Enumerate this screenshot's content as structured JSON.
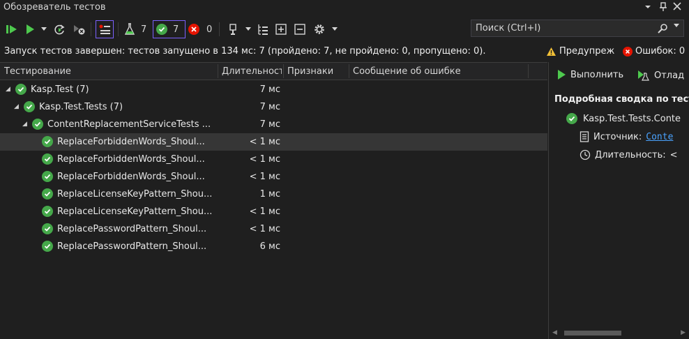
{
  "window": {
    "title": "Обозреватель тестов"
  },
  "toolbar": {
    "flask_count": "7",
    "passed_count": "7",
    "failed_count": "0"
  },
  "search": {
    "placeholder": "Поиск (Ctrl+I)"
  },
  "status": {
    "message": "Запуск тестов завершен: тестов запущено в 134 мс: 7 (пройдено: 7, не пройдено: 0, пропущено: 0).",
    "warnings_label": "Предупреж",
    "errors_label": "Ошибок: 0"
  },
  "columns": [
    "Тестирование",
    "Длительност",
    "Признаки",
    "Сообщение об ошибке"
  ],
  "rows": [
    {
      "name": "Kasp.Test",
      "count": "(7)",
      "duration": "7 мс"
    },
    {
      "name": "Kasp.Test.Tests",
      "count": "(7)",
      "duration": "7 мс"
    },
    {
      "name": "ContentReplacementServiceTests ...",
      "count": "",
      "duration": "7 мс"
    },
    {
      "name": "ReplaceForbiddenWords_Shoul...",
      "count": "",
      "duration": "< 1 мс"
    },
    {
      "name": "ReplaceForbiddenWords_Shoul...",
      "count": "",
      "duration": "< 1 мс"
    },
    {
      "name": "ReplaceForbiddenWords_Shoul...",
      "count": "",
      "duration": "< 1 мс"
    },
    {
      "name": "ReplaceLicenseKeyPattern_Shou...",
      "count": "",
      "duration": "1 мс"
    },
    {
      "name": "ReplaceLicenseKeyPattern_Shou...",
      "count": "",
      "duration": "< 1 мс"
    },
    {
      "name": "ReplacePasswordPattern_Shoul...",
      "count": "",
      "duration": "< 1 мс"
    },
    {
      "name": "ReplacePasswordPattern_Shoul...",
      "count": "",
      "duration": "6 мс"
    }
  ],
  "details": {
    "run_label": "Выполнить",
    "debug_label": "Отлад",
    "summary_title": "Подробная сводка по тесту",
    "test_name": "Kasp.Test.Tests.Conte",
    "source_label": "Источник:",
    "source_link": "Conte",
    "duration_label": "Длительность:",
    "duration_value": "<"
  },
  "colors": {
    "accent_pass": "#45a84a",
    "accent_fail": "#e51400",
    "warning": "#f2c037",
    "link": "#4aa3ff",
    "play": "#4ec94e"
  }
}
